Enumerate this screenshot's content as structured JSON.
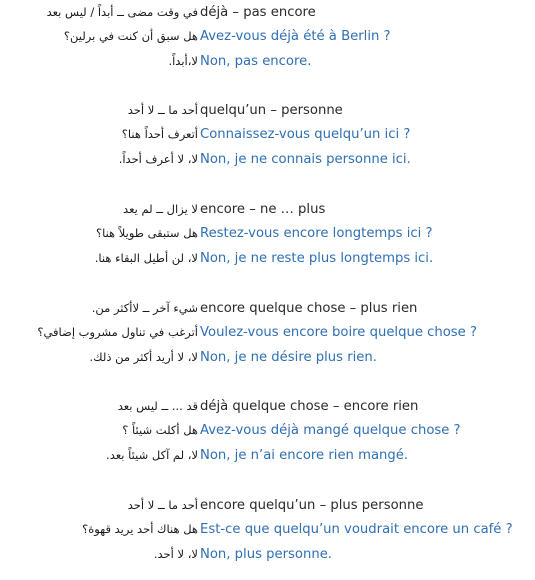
{
  "groups": [
    {
      "head": {
        "fr": "déjà – pas encore",
        "ar": "في وقت مضى ــ أبداً / ليس بعد"
      },
      "question": {
        "fr": "Avez-vous déjà été à Berlin ?",
        "ar": "هل سبق أن كنت في برلين؟"
      },
      "answer": {
        "fr": "Non, pas encore.",
        "ar": "لا،أبداً."
      }
    },
    {
      "head": {
        "fr": "quelqu’un – personne",
        "ar": "أحد ما ــ لا أحد"
      },
      "question": {
        "fr": "Connaissez-vous quelqu’un ici ?",
        "ar": "أتعرف أحداً هنا؟"
      },
      "answer": {
        "fr": "Non, je ne connais personne ici.",
        "ar": "لا، لا أعرف أحداً."
      }
    },
    {
      "head": {
        "fr": "encore – ne … plus",
        "ar": "لا يزال ــ لم يعد"
      },
      "question": {
        "fr": "Restez-vous encore longtemps ici ?",
        "ar": "هل ستبقى طويلاً هنا؟"
      },
      "answer": {
        "fr": "Non, je ne reste plus longtemps ici.",
        "ar": "لا، لن أطيل البقاء هنا."
      }
    },
    {
      "head": {
        "fr": "encore quelque chose – plus rien",
        "ar": "شيء آخر ــ لاأكثر من."
      },
      "question": {
        "fr": "Voulez-vous encore boire quelque chose ?",
        "ar": "أترغب في تناول مشروب إضافي؟"
      },
      "answer": {
        "fr": "Non, je ne désire plus rien.",
        "ar": "لا، لا أريد أكثر من ذلك."
      }
    },
    {
      "head": {
        "fr": "déjà quelque chose – encore rien",
        "ar": "قد ... ــ ليس بعد"
      },
      "question": {
        "fr": "Avez-vous déjà mangé quelque chose ?",
        "ar": "هل أكلت شيئاً ؟"
      },
      "answer": {
        "fr": "Non, je n’ai encore rien mangé.",
        "ar": "لا، لم آكل شيئاً بعد."
      }
    },
    {
      "head": {
        "fr": "encore quelqu’un – plus personne",
        "ar": "أحد ما ــ لا أحد"
      },
      "question": {
        "fr": "Est-ce que quelqu’un voudrait encore un café ?",
        "ar": "هل هناك أحد يريد قهوة؟"
      },
      "answer": {
        "fr": "Non, plus personne.",
        "ar": "لا، لا أحد."
      }
    }
  ]
}
